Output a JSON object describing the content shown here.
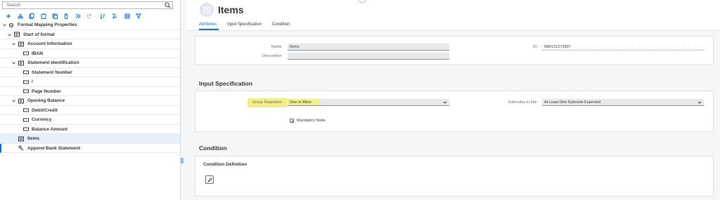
{
  "search": {
    "placeholder": "Search"
  },
  "tree": {
    "items": [
      {
        "label": "Format Mapping Properties"
      },
      {
        "label": "Start of format"
      },
      {
        "label": "Account Information"
      },
      {
        "label": "IBAN"
      },
      {
        "label": "Statement Identification"
      },
      {
        "label": "Statement Number"
      },
      {
        "label": "/"
      },
      {
        "label": "Page Number"
      },
      {
        "label": "Opening Balance"
      },
      {
        "label": "Debit/Credit"
      },
      {
        "label": "Currency"
      },
      {
        "label": "Balance Amount"
      },
      {
        "label": "Items"
      },
      {
        "label": "Append Bank Statement"
      }
    ]
  },
  "header": {
    "title": "Items",
    "tabs": [
      {
        "label": "Attributes"
      },
      {
        "label": "Input Specification"
      },
      {
        "label": "Condition"
      }
    ]
  },
  "attributes": {
    "name_label": "Name:",
    "name_value": "Items",
    "description_label": "Description:",
    "description_value": "",
    "id_label": "ID:",
    "id_value": "N00131273307"
  },
  "input_spec": {
    "title": "Input Specification",
    "group_repetition_label": "Group Repetition:",
    "group_repetition_value": "One or More",
    "subnodes_label": "Subnodes in File:",
    "subnodes_value": "At Least One Subnode Expected",
    "mandatory_label": "Mandatory Node",
    "mandatory_checked": true
  },
  "condition": {
    "title": "Condition",
    "definition_title": "Condition Definition"
  },
  "colors": {
    "accent": "#0a6ed1",
    "highlight": "#f3ef86",
    "selected_row": "#e5f0fa"
  }
}
